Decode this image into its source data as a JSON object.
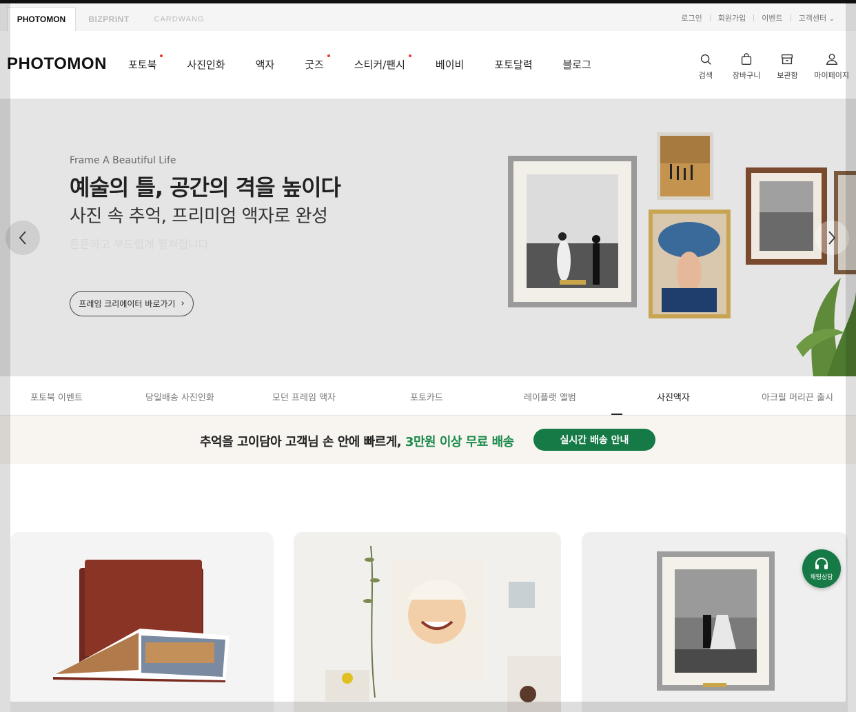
{
  "brand_tabs": [
    "PHOTOMON",
    "BIZPRINT",
    "CARDWANG"
  ],
  "util_links": [
    "로그인",
    "회원가입",
    "이벤트",
    "고객센터"
  ],
  "util_chevron": "⌄",
  "logo": "PHOTOMON",
  "gnb": [
    {
      "label": "포토북",
      "dot": true
    },
    {
      "label": "사진인화",
      "dot": false
    },
    {
      "label": "액자",
      "dot": false
    },
    {
      "label": "굿즈",
      "dot": true
    },
    {
      "label": "스티커/팬시",
      "dot": true
    },
    {
      "label": "베이비",
      "dot": false
    },
    {
      "label": "포토달력",
      "dot": false
    },
    {
      "label": "블로그",
      "dot": false
    }
  ],
  "header_icons": [
    {
      "label": "검색",
      "icon": "search-icon"
    },
    {
      "label": "장바구니",
      "icon": "shopping-bag-icon"
    },
    {
      "label": "보관함",
      "icon": "archive-box-icon"
    },
    {
      "label": "마이페이지",
      "icon": "user-icon"
    }
  ],
  "hero": {
    "subtitle": "Frame A Beautiful Life",
    "title": "예술의 틀, 공간의 격을 높이다",
    "description": "사진 속 추억, 프리미엄 액자로 완성",
    "ghost_text": "튼튼하고 부드럽게 펼쳐집니다",
    "button_label": "프레임 크리에이터 바로가기",
    "button_arrow": "›"
  },
  "categories": [
    {
      "label": "포토북 이벤트",
      "active": false
    },
    {
      "label": "당일배송 사진인화",
      "active": false
    },
    {
      "label": "모던 프레임 액자",
      "active": false
    },
    {
      "label": "포토카드",
      "active": false
    },
    {
      "label": "레이플랫 앨범",
      "active": false
    },
    {
      "label": "사진액자",
      "active": true
    },
    {
      "label": "아크릴 머리끈 출시",
      "active": false
    }
  ],
  "shipping": {
    "text": "추억을 고이담아 고객님 손 안에 빠르게,",
    "highlight": "3만원 이상 무료 배송",
    "button_label": "실시간 배송 안내"
  },
  "chat": {
    "label": "채팅상담",
    "icon": "headset-icon"
  },
  "colors": {
    "accent_green": "#157a45",
    "highlight_green": "#1b8a4b",
    "dot_red": "#ee3333"
  }
}
